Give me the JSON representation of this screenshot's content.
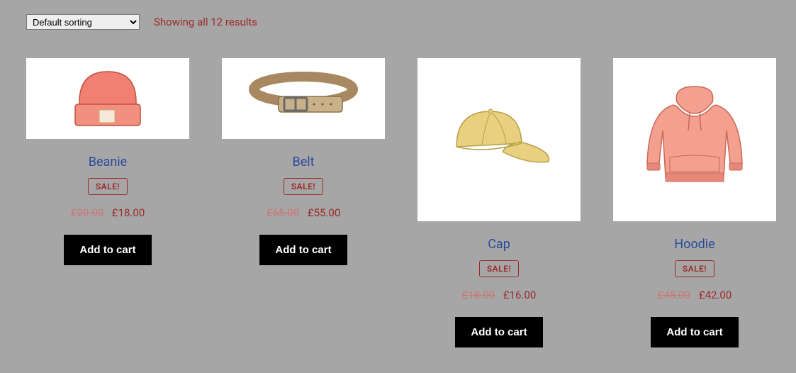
{
  "sort": {
    "selected": "Default sorting"
  },
  "results_text": "Showing all 12 results",
  "sale_label": "SALE!",
  "add_to_cart_label": "Add to cart",
  "products": [
    {
      "title": "Beanie",
      "old_price": "£20.00",
      "new_price": "£18.00"
    },
    {
      "title": "Belt",
      "old_price": "£65.00",
      "new_price": "£55.00"
    },
    {
      "title": "Cap",
      "old_price": "£18.00",
      "new_price": "£16.00"
    },
    {
      "title": "Hoodie",
      "old_price": "£45.00",
      "new_price": "£42.00"
    }
  ]
}
